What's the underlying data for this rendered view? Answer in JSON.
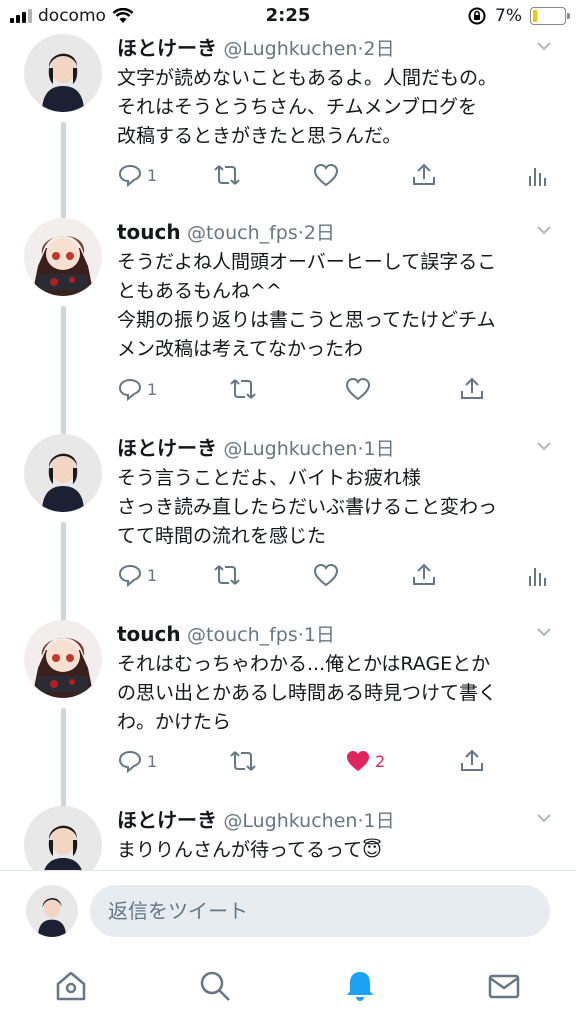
{
  "status_bar": {
    "carrier": "docomo",
    "time": "2:25",
    "battery": "7%"
  },
  "tweets": [
    {
      "name": "ほとけーき",
      "handle": "@Lughkuchen",
      "time": "2日",
      "lines": [
        "文字が読めないこともあるよ。人間だもの。",
        "それはそうとうちさん、チムメンブログを",
        "改稿するときがきたと思うんだ。"
      ],
      "reply_count": "1",
      "like_count": ""
    },
    {
      "name": "touch",
      "handle": "@touch_fps",
      "time": "2日",
      "lines": [
        "そうだよね人間頭オーバーヒーして誤字るこ",
        "ともあるもんね^^",
        "今期の振り返りは書こうと思ってたけどチム",
        "メン改稿は考えてなかったわ"
      ],
      "reply_count": "1",
      "like_count": ""
    },
    {
      "name": "ほとけーき",
      "handle": "@Lughkuchen",
      "time": "1日",
      "lines": [
        "そう言うことだよ、バイトお疲れ様",
        "さっき読み直したらだいぶ書けること変わっ",
        "てて時間の流れを感じた"
      ],
      "reply_count": "1",
      "like_count": ""
    },
    {
      "name": "touch",
      "handle": "@touch_fps",
      "time": "1日",
      "lines": [
        "それはむっちゃわかる...俺とかはRAGEとか",
        "の思い出とかあるし時間ある時見つけて書く",
        "わ。かけたら"
      ],
      "reply_count": "1",
      "like_count": "2"
    },
    {
      "name": "ほとけーき",
      "handle": "@Lughkuchen",
      "time": "1日",
      "lines": [
        "まりりんさんが待ってるって😇"
      ],
      "reply_count": "",
      "like_count": ""
    }
  ],
  "reply_placeholder": "返信をツイート",
  "colors": {
    "accent": "#1da1f2",
    "like": "#e0245e",
    "muted": "#657786",
    "thread": "#ccd6dd"
  },
  "tabs": [
    "home-icon",
    "search-icon",
    "notifications-icon",
    "messages-icon"
  ]
}
